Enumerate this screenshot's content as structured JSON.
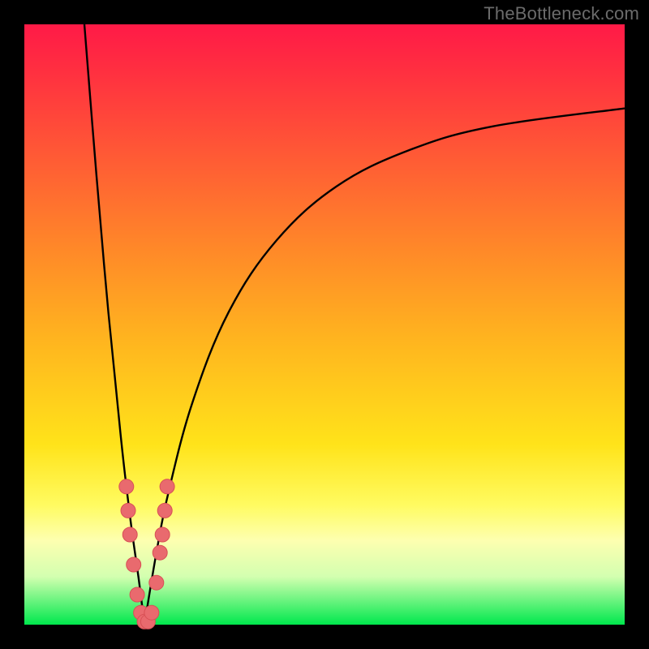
{
  "watermark": "TheBottleneck.com",
  "colors": {
    "frame": "#000000",
    "curve": "#000000",
    "marker_fill": "#e96a6e",
    "marker_stroke": "#d85055"
  },
  "chart_data": {
    "type": "line",
    "title": "",
    "xlabel": "",
    "ylabel": "",
    "xlim": [
      0,
      100
    ],
    "ylim": [
      0,
      100
    ],
    "x_optimum_pct": 20,
    "series": [
      {
        "name": "left-branch",
        "x": [
          10,
          12,
          14,
          16,
          17,
          18,
          19,
          20
        ],
        "y": [
          100,
          75,
          52,
          32,
          23,
          15,
          8,
          0
        ]
      },
      {
        "name": "right-branch",
        "x": [
          20,
          22,
          24,
          28,
          34,
          42,
          52,
          64,
          78,
          100
        ],
        "y": [
          0,
          12,
          22,
          37,
          52,
          64,
          73,
          79,
          83,
          86
        ]
      }
    ],
    "markers": {
      "name": "highlighted-points",
      "points": [
        {
          "x": 17.0,
          "y": 23
        },
        {
          "x": 17.3,
          "y": 19
        },
        {
          "x": 17.6,
          "y": 15
        },
        {
          "x": 18.2,
          "y": 10
        },
        {
          "x": 18.8,
          "y": 5
        },
        {
          "x": 19.4,
          "y": 2
        },
        {
          "x": 20.0,
          "y": 0.5
        },
        {
          "x": 20.6,
          "y": 0.5
        },
        {
          "x": 21.2,
          "y": 2
        },
        {
          "x": 22.0,
          "y": 7
        },
        {
          "x": 22.6,
          "y": 12
        },
        {
          "x": 23.0,
          "y": 15
        },
        {
          "x": 23.4,
          "y": 19
        },
        {
          "x": 23.8,
          "y": 23
        }
      ]
    }
  }
}
